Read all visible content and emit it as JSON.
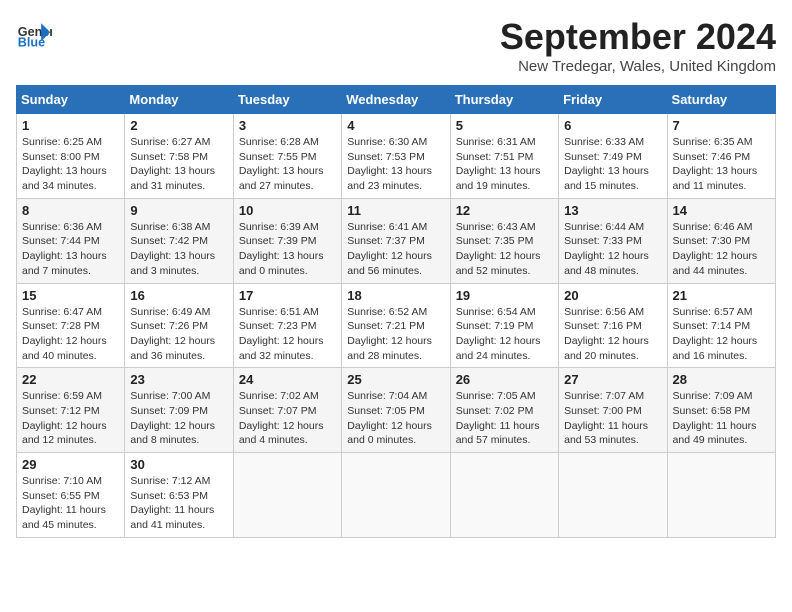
{
  "logo": {
    "line1": "General",
    "line2": "Blue"
  },
  "title": "September 2024",
  "subtitle": "New Tredegar, Wales, United Kingdom",
  "headers": [
    "Sunday",
    "Monday",
    "Tuesday",
    "Wednesday",
    "Thursday",
    "Friday",
    "Saturday"
  ],
  "weeks": [
    [
      {
        "num": "1",
        "info": "Sunrise: 6:25 AM\nSunset: 8:00 PM\nDaylight: 13 hours\nand 34 minutes."
      },
      {
        "num": "2",
        "info": "Sunrise: 6:27 AM\nSunset: 7:58 PM\nDaylight: 13 hours\nand 31 minutes."
      },
      {
        "num": "3",
        "info": "Sunrise: 6:28 AM\nSunset: 7:55 PM\nDaylight: 13 hours\nand 27 minutes."
      },
      {
        "num": "4",
        "info": "Sunrise: 6:30 AM\nSunset: 7:53 PM\nDaylight: 13 hours\nand 23 minutes."
      },
      {
        "num": "5",
        "info": "Sunrise: 6:31 AM\nSunset: 7:51 PM\nDaylight: 13 hours\nand 19 minutes."
      },
      {
        "num": "6",
        "info": "Sunrise: 6:33 AM\nSunset: 7:49 PM\nDaylight: 13 hours\nand 15 minutes."
      },
      {
        "num": "7",
        "info": "Sunrise: 6:35 AM\nSunset: 7:46 PM\nDaylight: 13 hours\nand 11 minutes."
      }
    ],
    [
      {
        "num": "8",
        "info": "Sunrise: 6:36 AM\nSunset: 7:44 PM\nDaylight: 13 hours\nand 7 minutes."
      },
      {
        "num": "9",
        "info": "Sunrise: 6:38 AM\nSunset: 7:42 PM\nDaylight: 13 hours\nand 3 minutes."
      },
      {
        "num": "10",
        "info": "Sunrise: 6:39 AM\nSunset: 7:39 PM\nDaylight: 13 hours\nand 0 minutes."
      },
      {
        "num": "11",
        "info": "Sunrise: 6:41 AM\nSunset: 7:37 PM\nDaylight: 12 hours\nand 56 minutes."
      },
      {
        "num": "12",
        "info": "Sunrise: 6:43 AM\nSunset: 7:35 PM\nDaylight: 12 hours\nand 52 minutes."
      },
      {
        "num": "13",
        "info": "Sunrise: 6:44 AM\nSunset: 7:33 PM\nDaylight: 12 hours\nand 48 minutes."
      },
      {
        "num": "14",
        "info": "Sunrise: 6:46 AM\nSunset: 7:30 PM\nDaylight: 12 hours\nand 44 minutes."
      }
    ],
    [
      {
        "num": "15",
        "info": "Sunrise: 6:47 AM\nSunset: 7:28 PM\nDaylight: 12 hours\nand 40 minutes."
      },
      {
        "num": "16",
        "info": "Sunrise: 6:49 AM\nSunset: 7:26 PM\nDaylight: 12 hours\nand 36 minutes."
      },
      {
        "num": "17",
        "info": "Sunrise: 6:51 AM\nSunset: 7:23 PM\nDaylight: 12 hours\nand 32 minutes."
      },
      {
        "num": "18",
        "info": "Sunrise: 6:52 AM\nSunset: 7:21 PM\nDaylight: 12 hours\nand 28 minutes."
      },
      {
        "num": "19",
        "info": "Sunrise: 6:54 AM\nSunset: 7:19 PM\nDaylight: 12 hours\nand 24 minutes."
      },
      {
        "num": "20",
        "info": "Sunrise: 6:56 AM\nSunset: 7:16 PM\nDaylight: 12 hours\nand 20 minutes."
      },
      {
        "num": "21",
        "info": "Sunrise: 6:57 AM\nSunset: 7:14 PM\nDaylight: 12 hours\nand 16 minutes."
      }
    ],
    [
      {
        "num": "22",
        "info": "Sunrise: 6:59 AM\nSunset: 7:12 PM\nDaylight: 12 hours\nand 12 minutes."
      },
      {
        "num": "23",
        "info": "Sunrise: 7:00 AM\nSunset: 7:09 PM\nDaylight: 12 hours\nand 8 minutes."
      },
      {
        "num": "24",
        "info": "Sunrise: 7:02 AM\nSunset: 7:07 PM\nDaylight: 12 hours\nand 4 minutes."
      },
      {
        "num": "25",
        "info": "Sunrise: 7:04 AM\nSunset: 7:05 PM\nDaylight: 12 hours\nand 0 minutes."
      },
      {
        "num": "26",
        "info": "Sunrise: 7:05 AM\nSunset: 7:02 PM\nDaylight: 11 hours\nand 57 minutes."
      },
      {
        "num": "27",
        "info": "Sunrise: 7:07 AM\nSunset: 7:00 PM\nDaylight: 11 hours\nand 53 minutes."
      },
      {
        "num": "28",
        "info": "Sunrise: 7:09 AM\nSunset: 6:58 PM\nDaylight: 11 hours\nand 49 minutes."
      }
    ],
    [
      {
        "num": "29",
        "info": "Sunrise: 7:10 AM\nSunset: 6:55 PM\nDaylight: 11 hours\nand 45 minutes."
      },
      {
        "num": "30",
        "info": "Sunrise: 7:12 AM\nSunset: 6:53 PM\nDaylight: 11 hours\nand 41 minutes."
      },
      null,
      null,
      null,
      null,
      null
    ]
  ]
}
